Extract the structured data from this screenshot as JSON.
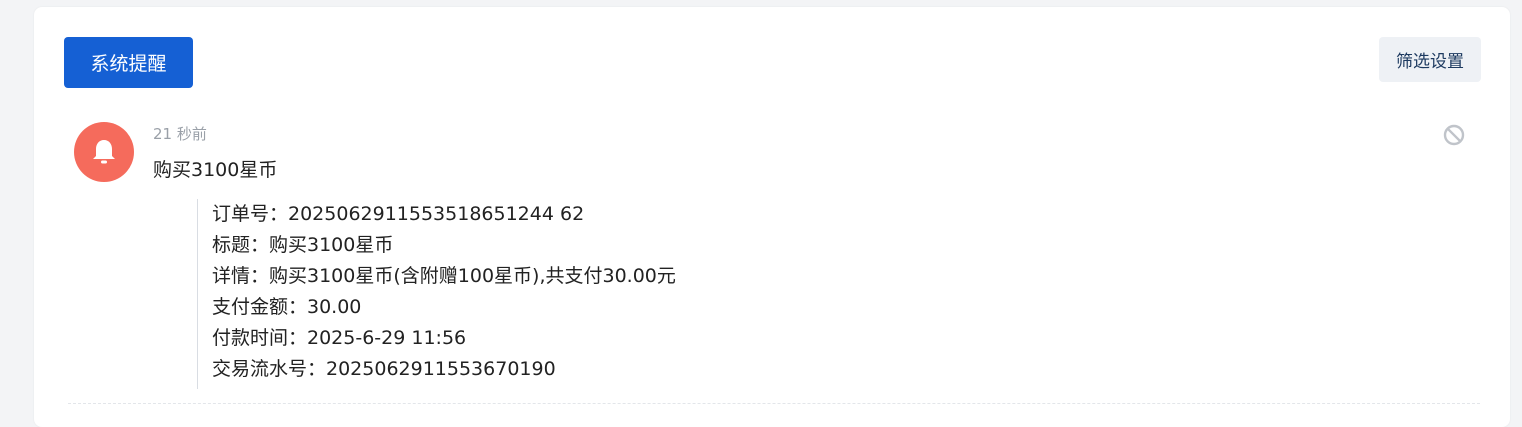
{
  "header": {
    "tab_label": "系统提醒",
    "filter_label": "筛选设置"
  },
  "notification": {
    "time": "21 秒前",
    "title": "购买3100星币",
    "icon": "bell-icon",
    "avatar_color": "#f56b5c",
    "details": [
      "订单号：2025062911553518651244 62",
      "标题：购买3100星币",
      "详情：购买3100星币(含附赠100星币),共支付30.00元",
      "支付金额：30.00",
      "付款时间：2025-6-29 11:56",
      "交易流水号：2025062911553670190"
    ]
  },
  "colors": {
    "primary": "#1560d4",
    "filter_bg": "#eef1f5"
  }
}
